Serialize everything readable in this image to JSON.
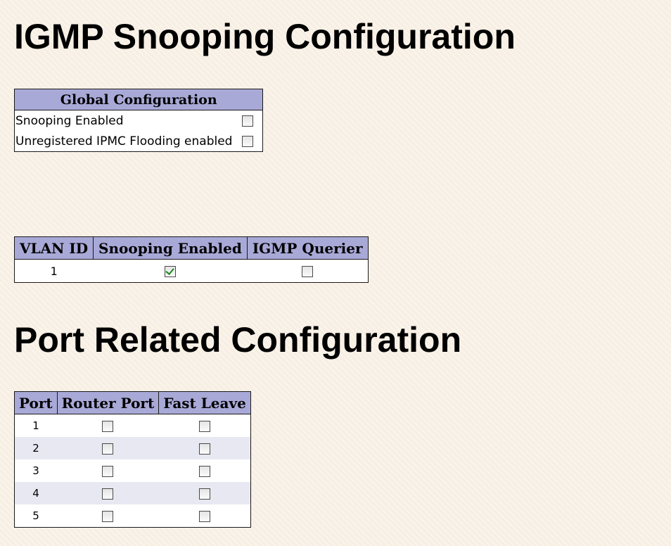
{
  "page_title": "IGMP Snooping Configuration",
  "global": {
    "header": "Global Configuration",
    "rows": [
      {
        "label": "Snooping Enabled",
        "checked": false
      },
      {
        "label": "Unregistered IPMC Flooding enabled",
        "checked": false
      }
    ]
  },
  "vlan": {
    "headers": [
      "VLAN ID",
      "Snooping Enabled",
      "IGMP Querier"
    ],
    "rows": [
      {
        "id": "1",
        "snooping": true,
        "querier": false
      }
    ]
  },
  "port_section_title": "Port Related Configuration",
  "ports": {
    "headers": [
      "Port",
      "Router Port",
      "Fast Leave"
    ],
    "rows": [
      {
        "port": "1",
        "router": false,
        "fast_leave": false
      },
      {
        "port": "2",
        "router": false,
        "fast_leave": false
      },
      {
        "port": "3",
        "router": false,
        "fast_leave": false
      },
      {
        "port": "4",
        "router": false,
        "fast_leave": false
      },
      {
        "port": "5",
        "router": false,
        "fast_leave": false
      }
    ]
  },
  "colors": {
    "header_bg": "#a9a9d8",
    "page_bg": "#f7efe3",
    "row_alt": "#e8e8f2",
    "check_mark": "#1a8a1a"
  }
}
